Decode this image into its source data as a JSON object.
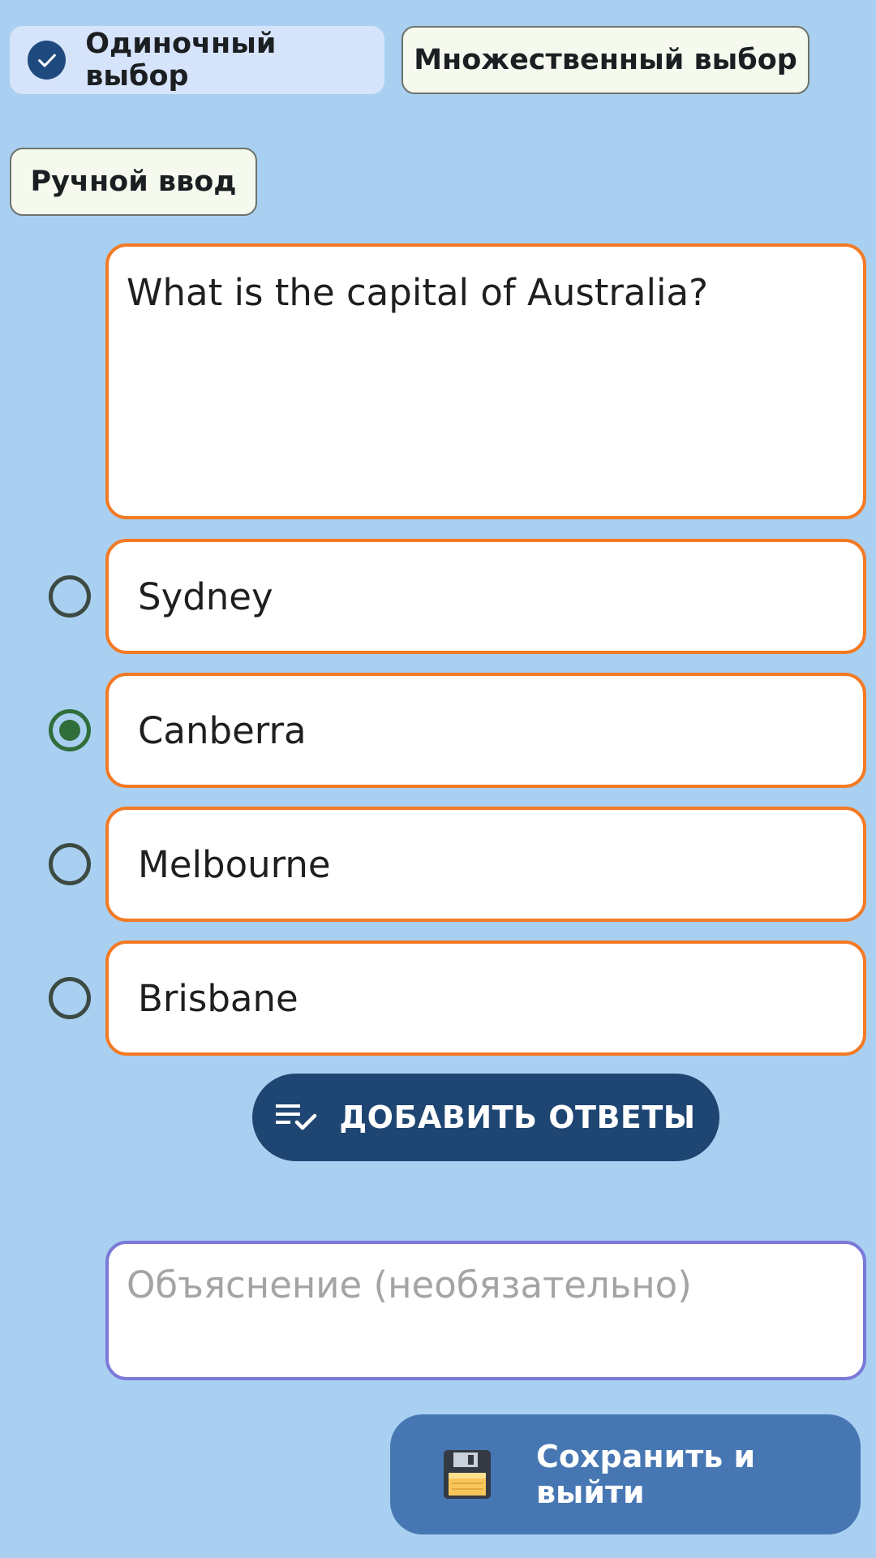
{
  "question_types": {
    "single": "Одиночный выбор",
    "multiple": "Множественный выбор",
    "manual": "Ручной ввод",
    "selected": "single"
  },
  "question": {
    "text": "What is the capital of Australia?"
  },
  "answers": [
    {
      "text": "Sydney",
      "selected": false
    },
    {
      "text": "Canberra",
      "selected": true
    },
    {
      "text": "Melbourne",
      "selected": false
    },
    {
      "text": "Brisbane",
      "selected": false
    }
  ],
  "add_answers_button": {
    "label": "ДОБАВИТЬ ОТВЕТЫ",
    "icon": "playlist-add-check-icon"
  },
  "explanation": {
    "value": "",
    "placeholder": "Объяснение (необязательно)"
  },
  "save_button": {
    "label": "Сохранить и выйти",
    "icon": "floppy-disk-icon"
  },
  "colors": {
    "background": "#a9d0f0",
    "chip_selected": "#d6e4fb",
    "chip_outline": "#f6f9ee",
    "answer_border": "#f37a24",
    "explanation_border": "#7b79d8",
    "add_button": "#1f4673",
    "save_button": "#4777b3",
    "radio_checked": "#2f6d3a"
  }
}
